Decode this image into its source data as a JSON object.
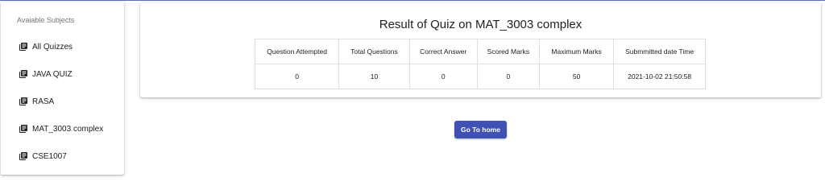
{
  "sidebar": {
    "header": "Avaiable Subjects",
    "items": [
      {
        "label": "All Quizzes",
        "icon": "library-books-icon"
      },
      {
        "label": "JAVA QUIZ",
        "icon": "library-books-icon"
      },
      {
        "label": "RASA",
        "icon": "library-books-icon"
      },
      {
        "label": "MAT_3003 complex",
        "icon": "library-books-icon"
      },
      {
        "label": "CSE1007",
        "icon": "library-books-icon"
      }
    ]
  },
  "result": {
    "title": "Result of Quiz on MAT_3003 complex",
    "headers": [
      "Question Attempted",
      "Total Questions",
      "Correct Answer",
      "Scored Marks",
      "Maximum Marks",
      "Submmitted date Time"
    ],
    "row": [
      "0",
      "10",
      "0",
      "0",
      "50",
      "2021-10-02 21:50:58"
    ]
  },
  "actions": {
    "home_button": "Go To home"
  },
  "colors": {
    "primary": "#3f51b5",
    "accent_line": "#5c6bc0"
  }
}
